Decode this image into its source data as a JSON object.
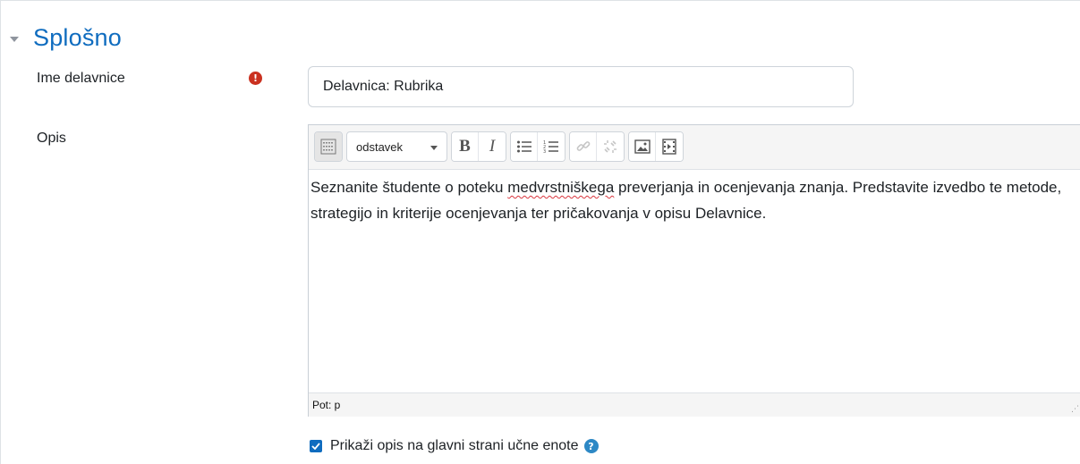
{
  "section": {
    "title": "Splošno",
    "collapse_icon": "caret-down-icon"
  },
  "fields": {
    "name": {
      "label": "Ime delavnice",
      "value": "Delavnica: Rubrika",
      "required_icon": "exclamation-circle-icon"
    },
    "description": {
      "label": "Opis",
      "toolbar": {
        "toggle_icon": "toolbar-toggle-icon",
        "paragraph_select": "odstavek",
        "bold_label": "B",
        "italic_label": "I",
        "unordered_list_icon": "unordered-list-icon",
        "ordered_list_icon": "ordered-list-icon",
        "link_icon": "link-icon",
        "unlink_icon": "unlink-icon",
        "image_icon": "image-icon",
        "media_icon": "media-icon"
      },
      "content": {
        "before": "Seznanite študente o poteku ",
        "misspelled": "medvrstniškega",
        "after": " preverjanja in ocenjevanja znanja. Predstavite izvedbo te metode, strategijo in kriterije ocenjevanja ter pričakovanja v opisu Delavnice."
      },
      "path": "Pot: p"
    },
    "show_description": {
      "label": "Prikaži opis na glavni strani učne enote",
      "checked": true,
      "help_icon": "question-circle-icon"
    }
  },
  "colors": {
    "accent": "#0f6cbf",
    "required": "#ca3120",
    "help": "#2d88c5"
  }
}
